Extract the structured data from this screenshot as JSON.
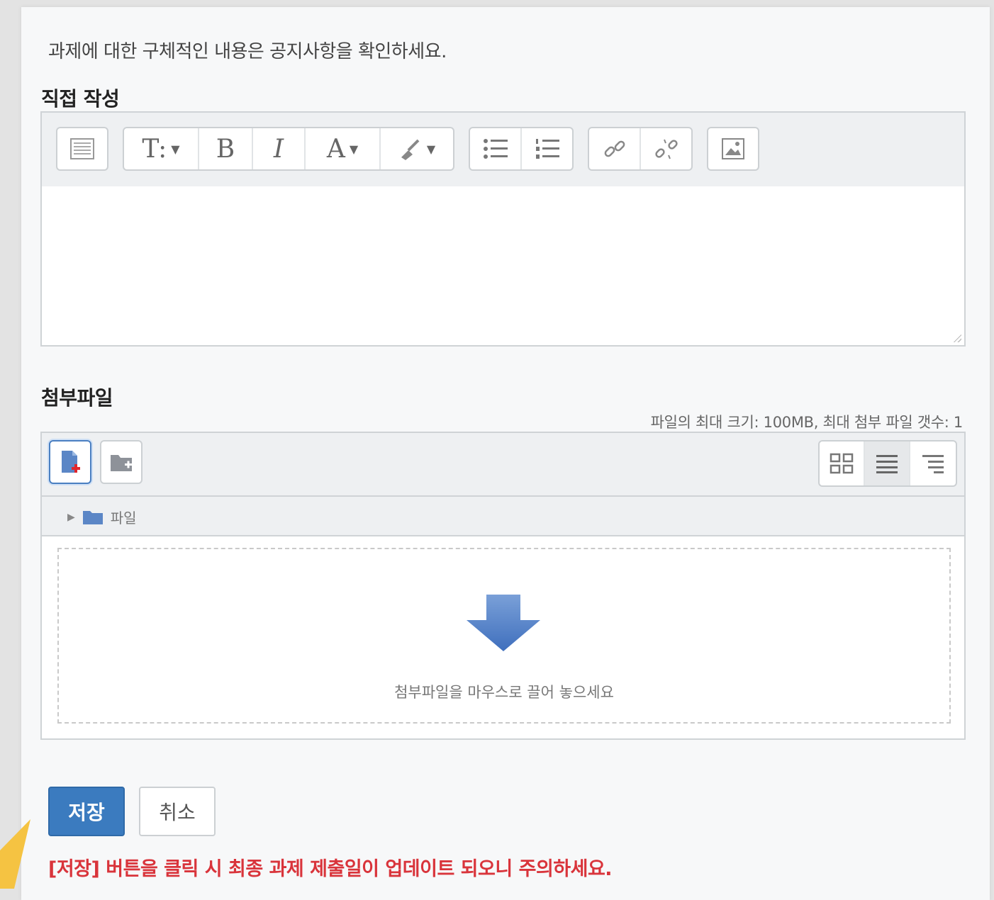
{
  "notice": "과제에 대한 구체적인 내용은 공지사항을 확인하세요.",
  "editor": {
    "label": "직접 작성",
    "toolbar": {
      "collapse_icon": "keyboard-icon",
      "format_glyph": "T:",
      "bold_glyph": "B",
      "italic_glyph": "I",
      "font_color_glyph": "A",
      "highlight_icon": "highlighter-icon",
      "bullet_list_icon": "bullet-list-icon",
      "numbered_list_icon": "numbered-list-icon",
      "link_icon": "link-icon",
      "unlink_icon": "unlink-icon",
      "image_icon": "image-icon"
    }
  },
  "attachments": {
    "label": "첨부파일",
    "limits": "파일의 최대 크기: 100MB, 최대 첨부 파일 갯수: 1",
    "path_folder": "파일",
    "drop_text": "첨부파일을 마우스로 끌어 놓으세요",
    "view_modes": [
      "grid",
      "list",
      "tree"
    ],
    "active_view": "list"
  },
  "actions": {
    "save_label": "저장",
    "cancel_label": "취소"
  },
  "warning": "[저장] 버튼을 클릭 시 최종 과제 제출일이 업데이트 되오니 주의하세요.",
  "colors": {
    "primary": "#3b7bbf",
    "warning": "#d9343b",
    "pointer": "#f5c342",
    "drop_arrow": "#4f7ec8"
  }
}
